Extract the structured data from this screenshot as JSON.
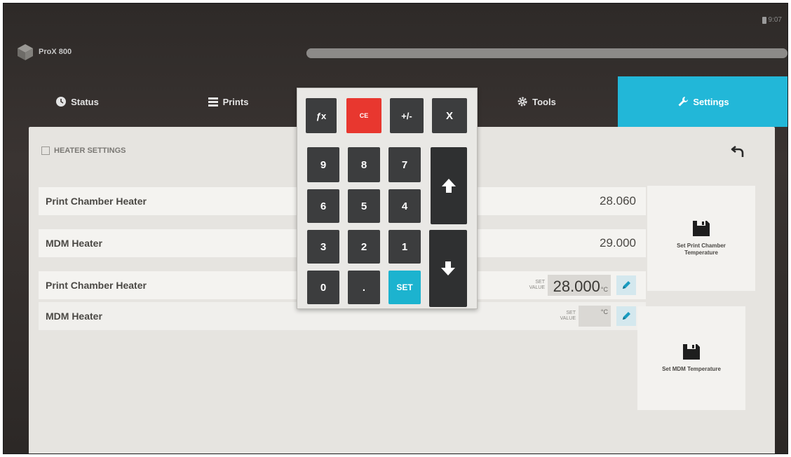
{
  "window": {
    "clock": "9:07"
  },
  "brand": {
    "name": "ProX 800"
  },
  "progress": {
    "fraction": 1.0
  },
  "nav": {
    "status": "Status",
    "prints": "Prints",
    "tools": "Tools",
    "settings": "Settings",
    "active": "Settings",
    "accent_color": "#22b7d8"
  },
  "section": {
    "title": "HEATER SETTINGS"
  },
  "readings": [
    {
      "label": "Print Chamber Heater",
      "value": "28.060"
    },
    {
      "label": "MDM Heater",
      "value": "29.000"
    }
  ],
  "setpoints": [
    {
      "label": "Print Chamber Heater",
      "set_label_1": "SET",
      "set_label_2": "VALUE",
      "value": "28.000",
      "unit": "°C"
    },
    {
      "label": "MDM Heater",
      "set_label_1": "SET",
      "set_label_2": "VALUE",
      "value": "",
      "unit": "°C"
    }
  ],
  "actions": {
    "set_print_chamber": "Set Print Chamber Temperature",
    "set_mdm": "Set MDM Temperature"
  },
  "keypad": {
    "fx": "ƒx",
    "ce": "CE",
    "plusminus": "+/-",
    "close": "X",
    "k9": "9",
    "k8": "8",
    "k7": "7",
    "k6": "6",
    "k5": "5",
    "k4": "4",
    "k3": "3",
    "k2": "2",
    "k1": "1",
    "k0": "0",
    "dot": ".",
    "set": "SET",
    "ce_color": "#e8372f",
    "set_color": "#1cb3cf"
  }
}
